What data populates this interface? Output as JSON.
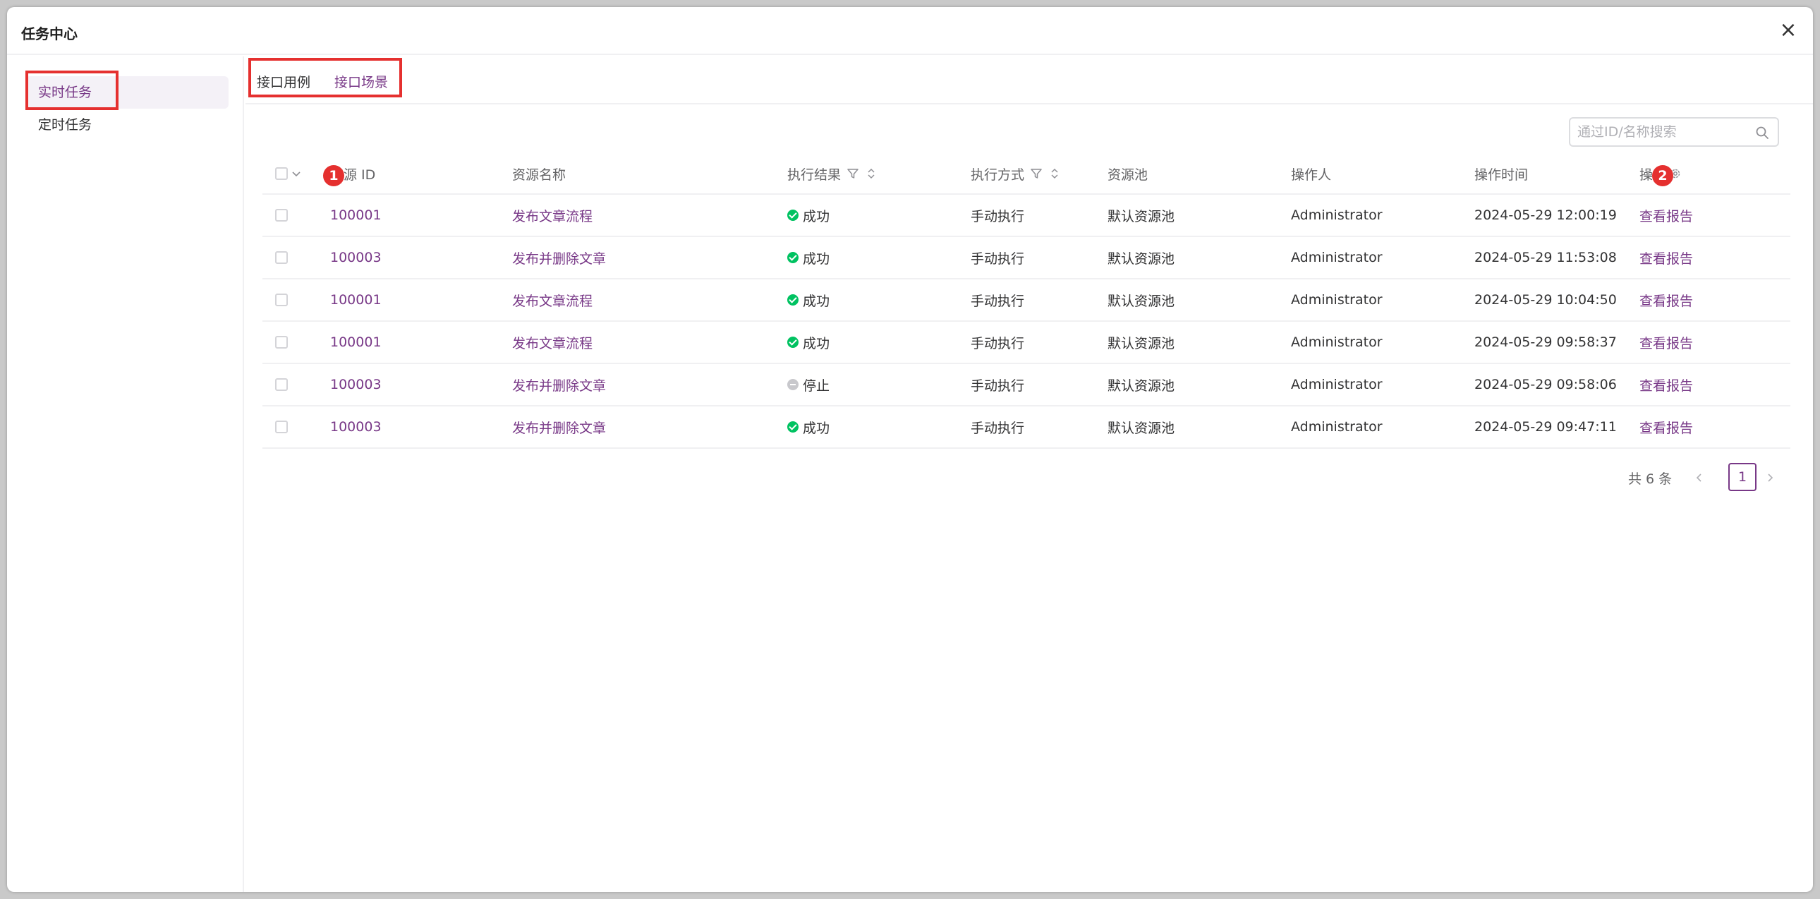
{
  "modal": {
    "title": "任务中心",
    "close_symbol": "×"
  },
  "sidebar": {
    "items": [
      {
        "label": "实时任务"
      },
      {
        "label": "定时任务"
      }
    ]
  },
  "tabs": [
    {
      "label": "接口用例"
    },
    {
      "label": "接口场景"
    }
  ],
  "search": {
    "placeholder": "通过ID/名称搜索",
    "value": ""
  },
  "table": {
    "headers": {
      "resource_id": "资源 ID",
      "resource_name": "资源名称",
      "result": "执行结果",
      "method": "执行方式",
      "pool": "资源池",
      "operator": "操作人",
      "time": "操作时间",
      "action": "操作"
    },
    "rows": [
      {
        "id": "100001",
        "name": "发布文章流程",
        "status": "success",
        "result": "成功",
        "method": "手动执行",
        "pool": "默认资源池",
        "operator": "Administrator",
        "time": "2024-05-29 12:00:19",
        "action": "查看报告"
      },
      {
        "id": "100003",
        "name": "发布并删除文章",
        "status": "success",
        "result": "成功",
        "method": "手动执行",
        "pool": "默认资源池",
        "operator": "Administrator",
        "time": "2024-05-29 11:53:08",
        "action": "查看报告"
      },
      {
        "id": "100001",
        "name": "发布文章流程",
        "status": "success",
        "result": "成功",
        "method": "手动执行",
        "pool": "默认资源池",
        "operator": "Administrator",
        "time": "2024-05-29 10:04:50",
        "action": "查看报告"
      },
      {
        "id": "100001",
        "name": "发布文章流程",
        "status": "success",
        "result": "成功",
        "method": "手动执行",
        "pool": "默认资源池",
        "operator": "Administrator",
        "time": "2024-05-29 09:58:37",
        "action": "查看报告"
      },
      {
        "id": "100003",
        "name": "发布并删除文章",
        "status": "stopped",
        "result": "停止",
        "method": "手动执行",
        "pool": "默认资源池",
        "operator": "Administrator",
        "time": "2024-05-29 09:58:06",
        "action": "查看报告"
      },
      {
        "id": "100003",
        "name": "发布并删除文章",
        "status": "success",
        "result": "成功",
        "method": "手动执行",
        "pool": "默认资源池",
        "operator": "Administrator",
        "time": "2024-05-29 09:47:11",
        "action": "查看报告"
      }
    ]
  },
  "annotations": {
    "badge1": "1",
    "badge2": "2"
  },
  "pagination": {
    "total_text": "共 6 条",
    "current_page": "1"
  },
  "colors": {
    "accent": "#783887",
    "highlight": "#e5302f",
    "success": "#00c261",
    "stopped": "#c8c8cc"
  }
}
